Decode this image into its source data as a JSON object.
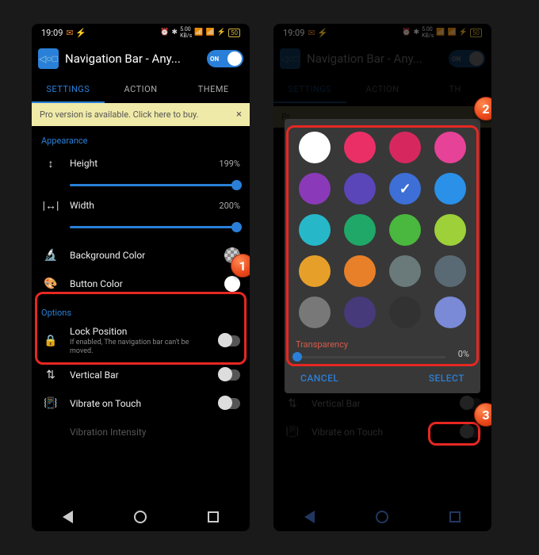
{
  "status": {
    "time": "19:09",
    "icons_left": "✉ ⚡",
    "icons_right": "⏰ ⏶ 5.00 KB/s ᴴᴰ ₁ ₂ ⚡ 50"
  },
  "header": {
    "title": "Navigation Bar - Any...",
    "toggle": "ON"
  },
  "tabs": {
    "t1": "SETTINGS",
    "t2": "ACTION",
    "t3": "THEME"
  },
  "banner": {
    "text": "Pro version is available. Click here to buy.",
    "close": "×"
  },
  "sections": {
    "appearance": "Appearance",
    "options": "Options"
  },
  "rows": {
    "height": {
      "label": "Height",
      "value": "199%"
    },
    "width": {
      "label": "Width",
      "value": "200%"
    },
    "bgcolor": {
      "label": "Background Color"
    },
    "btncolor": {
      "label": "Button Color"
    },
    "lock": {
      "label": "Lock Position",
      "sub": "If enabled, The navigation bar can't be moved."
    },
    "vbar": {
      "label": "Vertical Bar"
    },
    "vibrate": {
      "label": "Vibrate on Touch"
    },
    "vintensity": {
      "label": "Vibration Intensity"
    }
  },
  "dialog": {
    "transparency": "Transparency",
    "tvalue": "0%",
    "cancel": "CANCEL",
    "select": "SELECT",
    "colors": [
      "#ffffff",
      "#ea2f67",
      "#d6285f",
      "#e64298",
      "#8a3ab8",
      "#5a46b8",
      "#3d6fd6",
      "#2a90e8",
      "#26b8c8",
      "#1fa867",
      "#4ab83e",
      "#9ed03a",
      "#e6a02a",
      "#e8802a",
      "#6a7a7a",
      "#5a6a74",
      "#787878",
      "#463a7a",
      "#323232",
      "#7a8ad6"
    ],
    "selected_index": 6
  },
  "callouts": {
    "c1": "1",
    "c2": "2",
    "c3": "3"
  }
}
